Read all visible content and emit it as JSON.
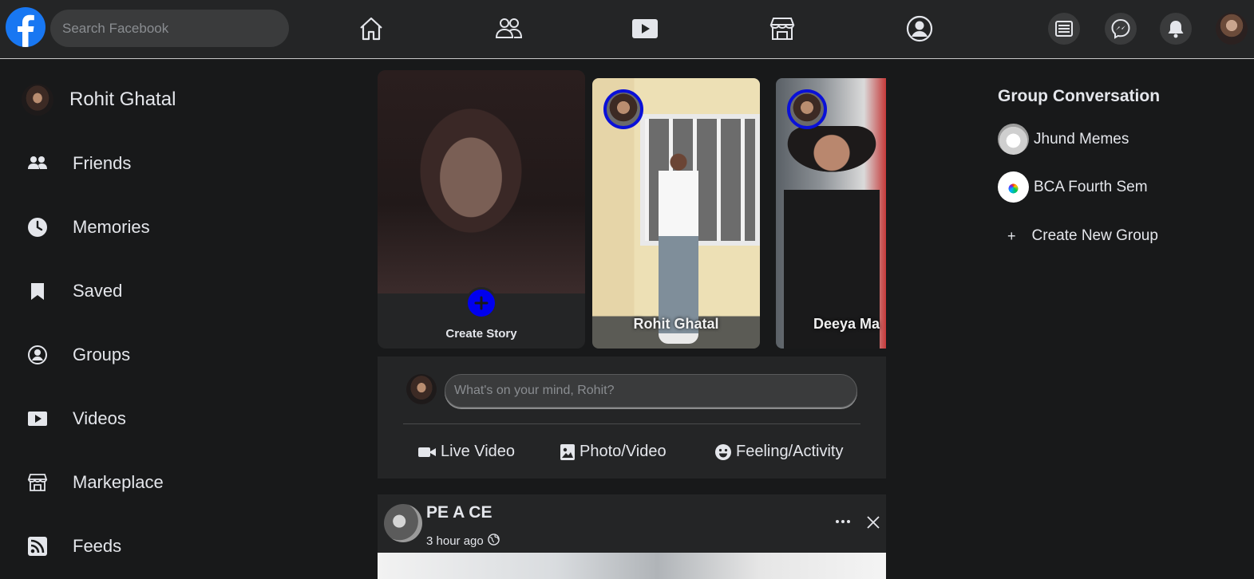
{
  "topbar": {
    "search_placeholder": "Search Facebook",
    "nav_icons": [
      "home-icon",
      "friends-icon",
      "watch-icon",
      "marketplace-icon",
      "profile-icon"
    ],
    "right_icons": [
      "news-icon",
      "messenger-icon",
      "notifications-icon"
    ],
    "brand_color": "#1877f2"
  },
  "sidebar": {
    "profile_name": "Rohit Ghatal",
    "items": [
      {
        "label": "Friends",
        "icon": "friends-icon"
      },
      {
        "label": "Memories",
        "icon": "clock-icon"
      },
      {
        "label": "Saved",
        "icon": "bookmark-icon"
      },
      {
        "label": "Groups",
        "icon": "user-circle-icon"
      },
      {
        "label": "Videos",
        "icon": "play-icon"
      },
      {
        "label": "Markeplace",
        "icon": "store-icon"
      },
      {
        "label": "Feeds",
        "icon": "rss-icon"
      }
    ]
  },
  "stories": {
    "create_label": "Create Story",
    "items": [
      {
        "name": "Rohit Ghatal"
      },
      {
        "name": "Deeya Ma"
      }
    ],
    "ring_color": "#0a10d8",
    "plus_color": "#0000ee"
  },
  "composer": {
    "placeholder": "What's on your mind, Rohit?",
    "actions": [
      {
        "label": "Live Video",
        "icon": "video-camera-icon"
      },
      {
        "label": "Photo/Video",
        "icon": "photo-icon"
      },
      {
        "label": "Feeling/Activity",
        "icon": "smile-icon"
      }
    ]
  },
  "post": {
    "author": "PE A CE",
    "time": "3 hour ago"
  },
  "right_panel": {
    "title": "Group Conversation",
    "groups": [
      {
        "name": "Jhund Memes"
      },
      {
        "name": "BCA Fourth Sem"
      }
    ],
    "create_label": "Create New Group",
    "create_symbol": "+"
  }
}
